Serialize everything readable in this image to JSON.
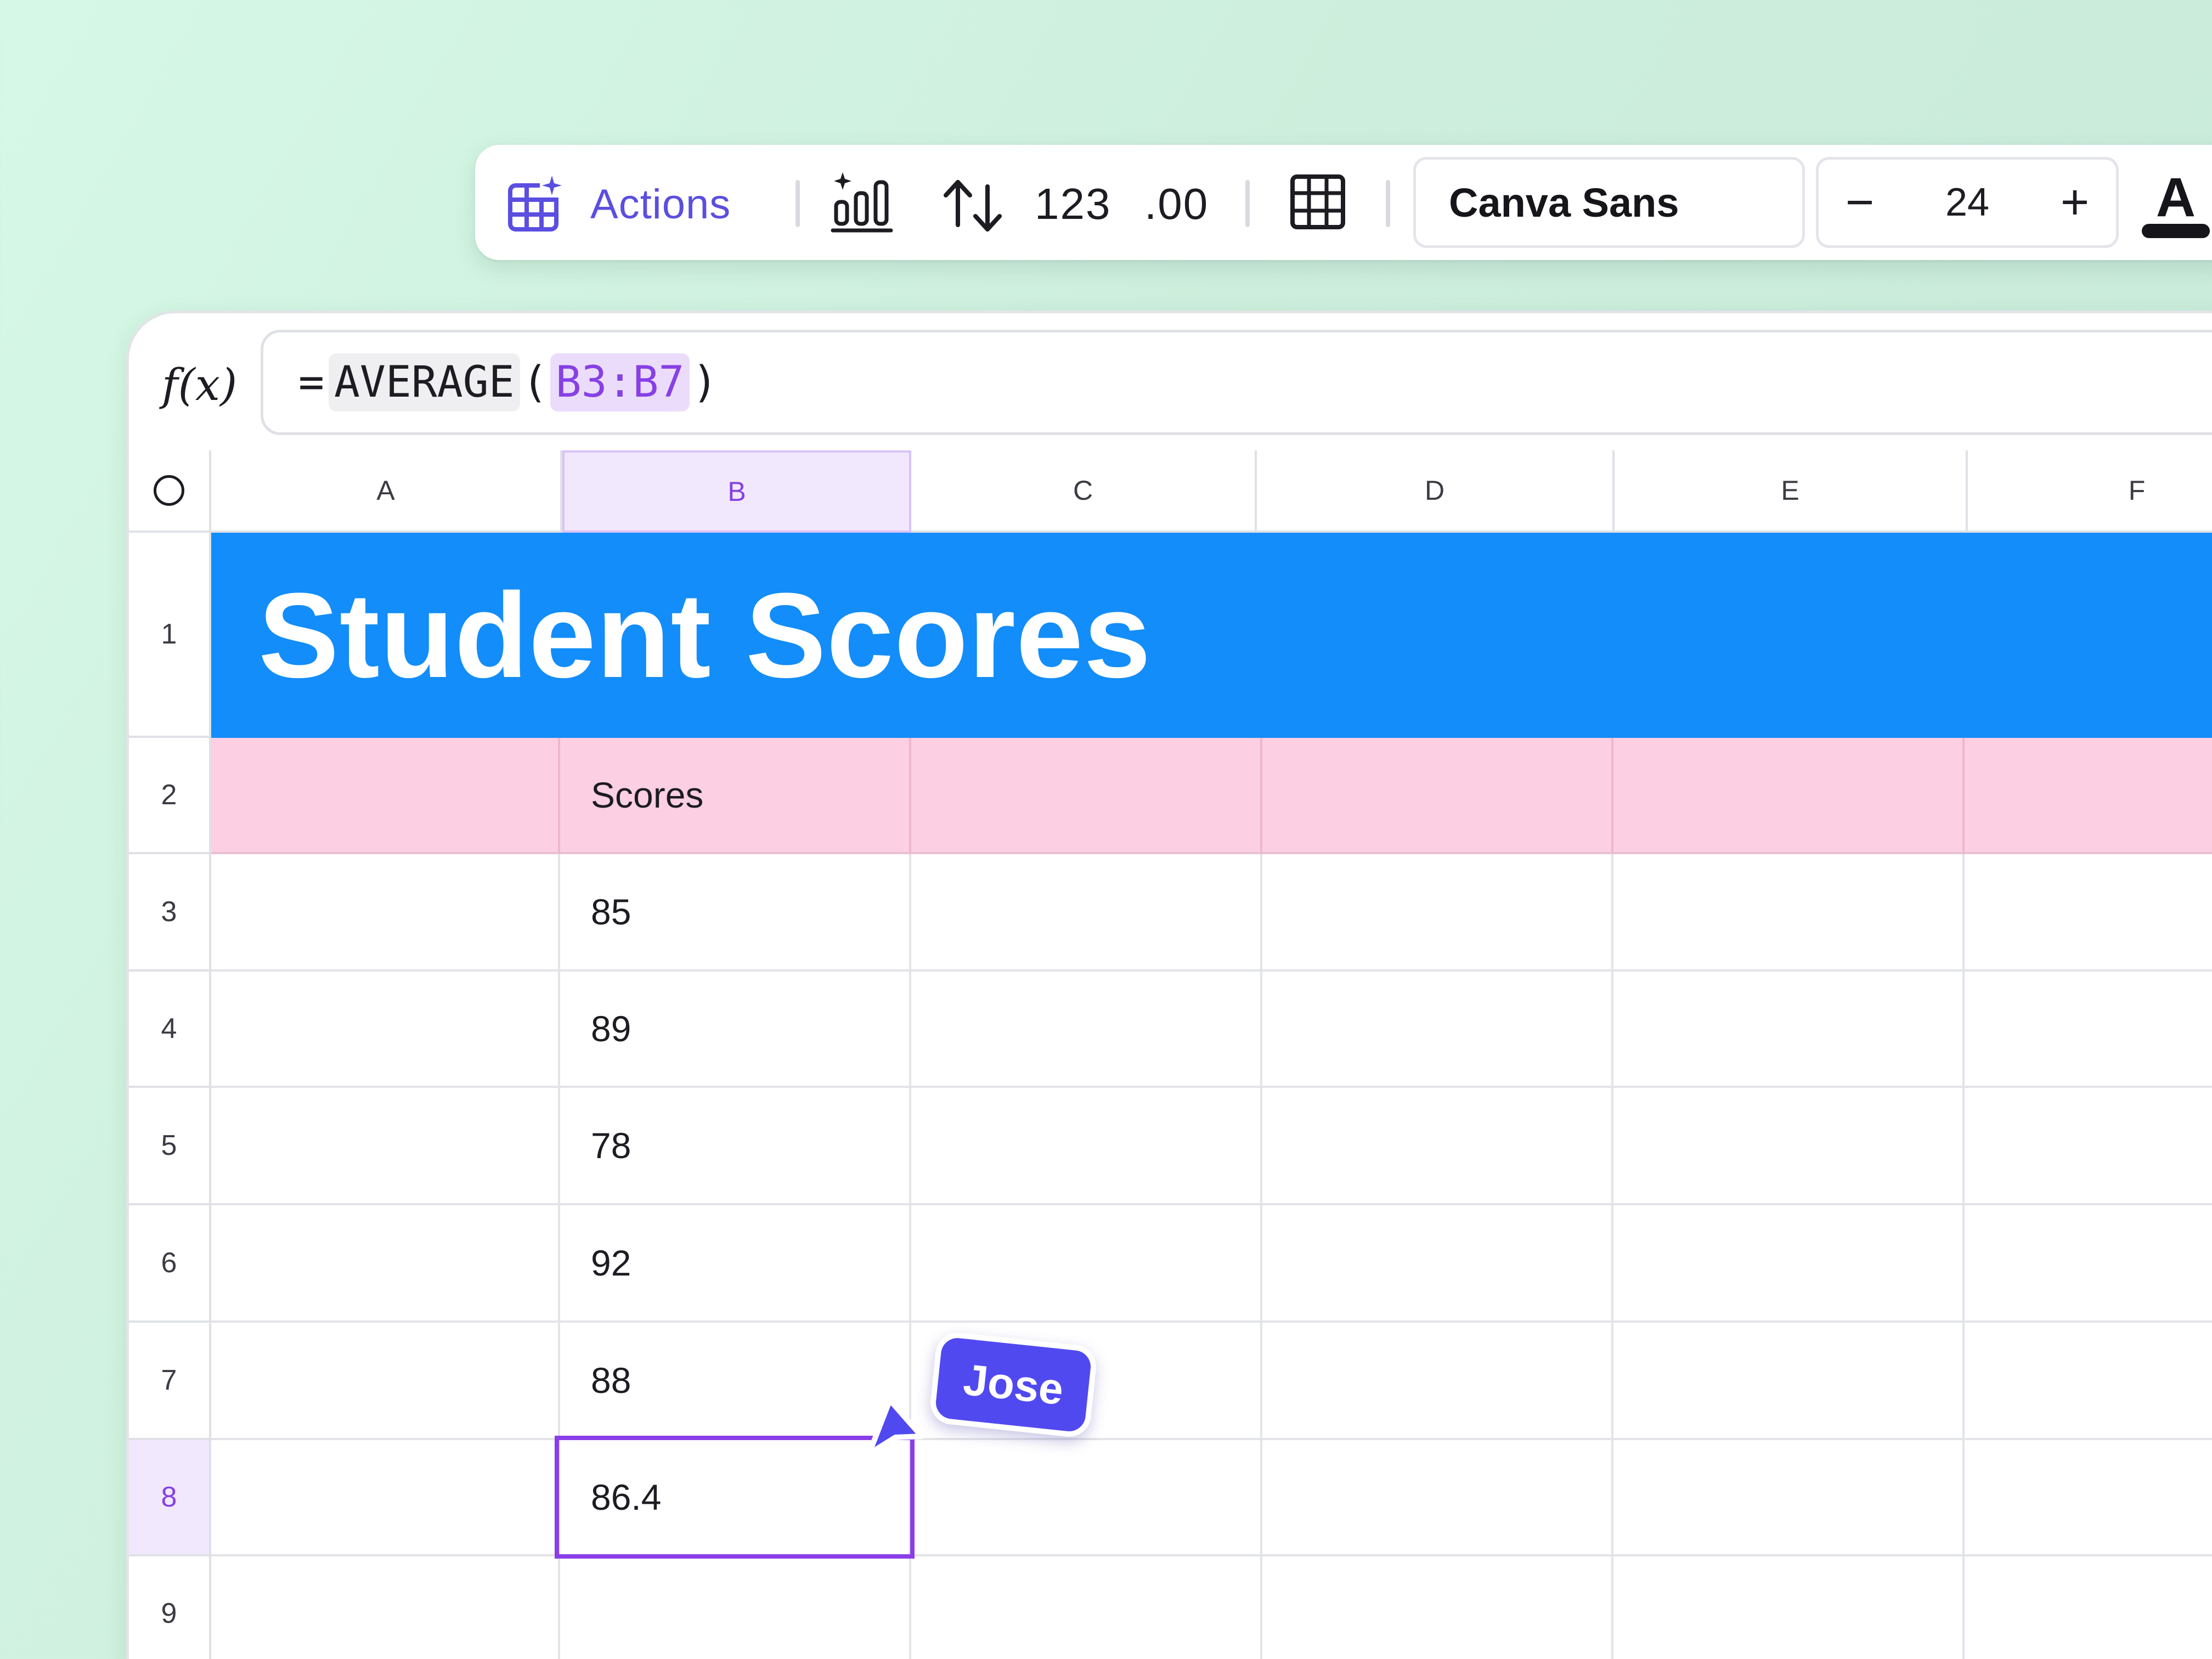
{
  "toolbar": {
    "actions_label": "Actions",
    "number_format_label": "123",
    "decimal_format_label": ".00",
    "font_name": "Canva Sans",
    "font_size": "24",
    "decrease_label": "−",
    "increase_label": "+",
    "text_color_label": "A",
    "accent_color": "#5b4ee0"
  },
  "formula_bar": {
    "fx_label": "f(x)",
    "equals": "=",
    "function_name": "AVERAGE",
    "open_paren": "(",
    "range_ref": "B3:B7",
    "close_paren": ")"
  },
  "columns": [
    "A",
    "B",
    "C",
    "D",
    "E",
    "F"
  ],
  "rows": [
    "1",
    "2",
    "3",
    "4",
    "5",
    "6",
    "7",
    "8",
    "9"
  ],
  "sheet": {
    "title": "Student Scores",
    "title_color": "#138df9",
    "header_label": "Scores",
    "header_color": "#fdcfe3",
    "scores": [
      "85",
      "89",
      "78",
      "92",
      "88"
    ],
    "result": "86.4",
    "selected_cell": "B8",
    "selection_color": "#8a3ee8"
  },
  "collaborator": {
    "name": "Jose",
    "color": "#5149f0"
  }
}
